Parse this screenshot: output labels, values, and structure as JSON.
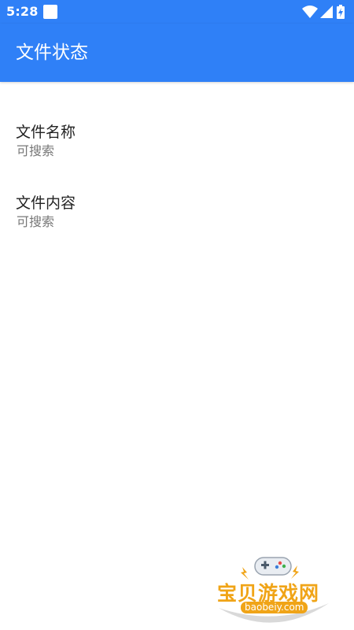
{
  "status_bar": {
    "time": "5:28",
    "icons": [
      "notification-square-icon",
      "wifi-icon",
      "cell-signal-icon",
      "battery-charging-icon"
    ],
    "color": "#2f80f7"
  },
  "app_bar": {
    "title": "文件状态",
    "color": "#2f80f7"
  },
  "preferences": [
    {
      "title": "文件名称",
      "summary": "可搜索"
    },
    {
      "title": "文件内容",
      "summary": "可搜索"
    }
  ],
  "watermark": {
    "text": "宝贝游戏网",
    "url": "baobeiy.com",
    "color": "#f0a417"
  }
}
